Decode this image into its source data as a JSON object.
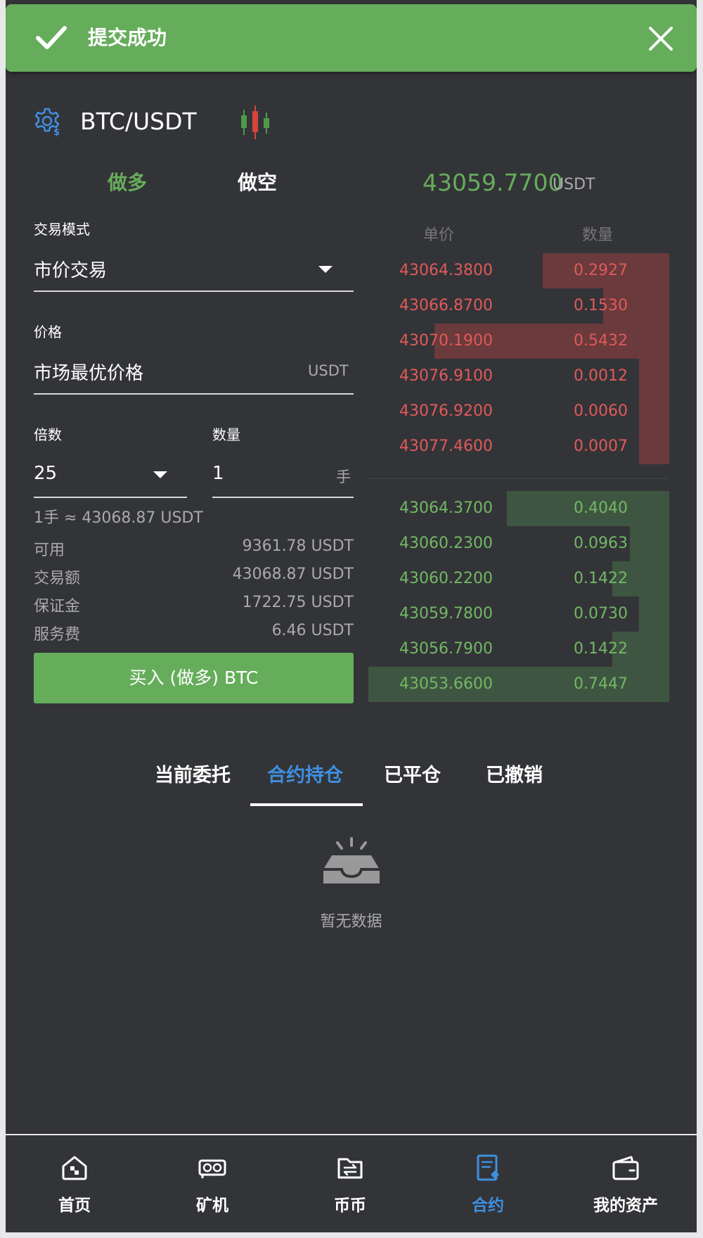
{
  "toast": {
    "message": "提交成功"
  },
  "header": {
    "pair": "BTC/USDT"
  },
  "trade_tabs": {
    "long": "做多",
    "short": "做空"
  },
  "ticker": {
    "last_price": "43059.7700",
    "unit": "USDT"
  },
  "form": {
    "mode_label": "交易模式",
    "mode_value": "市价交易",
    "price_label": "价格",
    "price_value": "市场最优价格",
    "price_unit": "USDT",
    "leverage_label": "倍数",
    "leverage_value": "25",
    "qty_label": "数量",
    "qty_value": "1",
    "qty_unit": "手",
    "per_lot": "1手 ≈ 43068.87 USDT"
  },
  "summary": [
    {
      "k": "可用",
      "v": "9361.78 USDT"
    },
    {
      "k": "交易额",
      "v": "43068.87 USDT"
    },
    {
      "k": "保证金",
      "v": "1722.75 USDT"
    },
    {
      "k": "服务费",
      "v": "6.46 USDT"
    }
  ],
  "buy_button": "买入 (做多) BTC",
  "orderbook": {
    "price_header": "单价",
    "qty_header": "数量",
    "asks": [
      {
        "price": "43064.3800",
        "qty": "0.2927",
        "depth": 0.42
      },
      {
        "price": "43066.8700",
        "qty": "0.1530",
        "depth": 0.22
      },
      {
        "price": "43070.1900",
        "qty": "0.5432",
        "depth": 0.78
      },
      {
        "price": "43076.9100",
        "qty": "0.0012",
        "depth": 0.1
      },
      {
        "price": "43076.9200",
        "qty": "0.0060",
        "depth": 0.1
      },
      {
        "price": "43077.4600",
        "qty": "0.0007",
        "depth": 0.1
      }
    ],
    "bids": [
      {
        "price": "43064.3700",
        "qty": "0.4040",
        "depth": 0.54
      },
      {
        "price": "43060.2300",
        "qty": "0.0963",
        "depth": 0.13
      },
      {
        "price": "43060.2200",
        "qty": "0.1422",
        "depth": 0.19
      },
      {
        "price": "43059.7800",
        "qty": "0.0730",
        "depth": 0.1
      },
      {
        "price": "43056.7900",
        "qty": "0.1422",
        "depth": 0.19
      },
      {
        "price": "43053.6600",
        "qty": "0.7447",
        "depth": 1.0
      }
    ]
  },
  "order_tabs": [
    "当前委托",
    "合约持仓",
    "已平仓",
    "已撤销"
  ],
  "empty_text": "暂无数据",
  "nav": [
    "首页",
    "矿机",
    "币币",
    "合约",
    "我的资产"
  ],
  "colors": {
    "green": "#66ad5b",
    "red": "#e05a5a",
    "blue": "#3f8fe0",
    "bg": "#333438"
  }
}
